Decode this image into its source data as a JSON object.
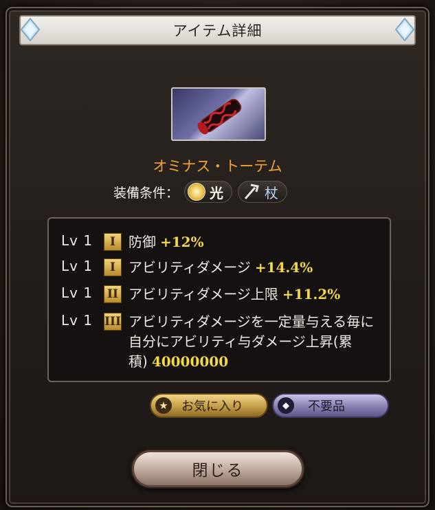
{
  "dialog": {
    "title": "アイテム詳細",
    "close_label": "閉じる"
  },
  "item": {
    "name": "オミナス・トーテム",
    "equip_label": "装備条件：",
    "element": {
      "label": "光",
      "icon": "light-element-icon"
    },
    "weapon": {
      "label": "杖",
      "icon": "staff-icon"
    }
  },
  "skills": [
    {
      "level": "Lv 1",
      "rank": "I",
      "text": "防御",
      "value": "+12%"
    },
    {
      "level": "Lv 1",
      "rank": "I",
      "text": "アビリティダメージ",
      "value": "+14.4%"
    },
    {
      "level": "Lv 1",
      "rank": "II",
      "text": "アビリティダメージ上限",
      "value": "+11.2%"
    },
    {
      "level": "Lv 1",
      "rank": "III",
      "text": "アビリティダメージを一定量与える毎に自分にアビリティ与ダメージ上昇(累積)",
      "value": "40000000"
    }
  ],
  "actions": {
    "favorite_label": "お気に入り",
    "junk_label": "不要品"
  },
  "colors": {
    "item_name": "#f0a23c",
    "skill_value": "#f2d94a",
    "favorite_gold": "#c9a24b",
    "junk_purple": "#8c85b6"
  }
}
